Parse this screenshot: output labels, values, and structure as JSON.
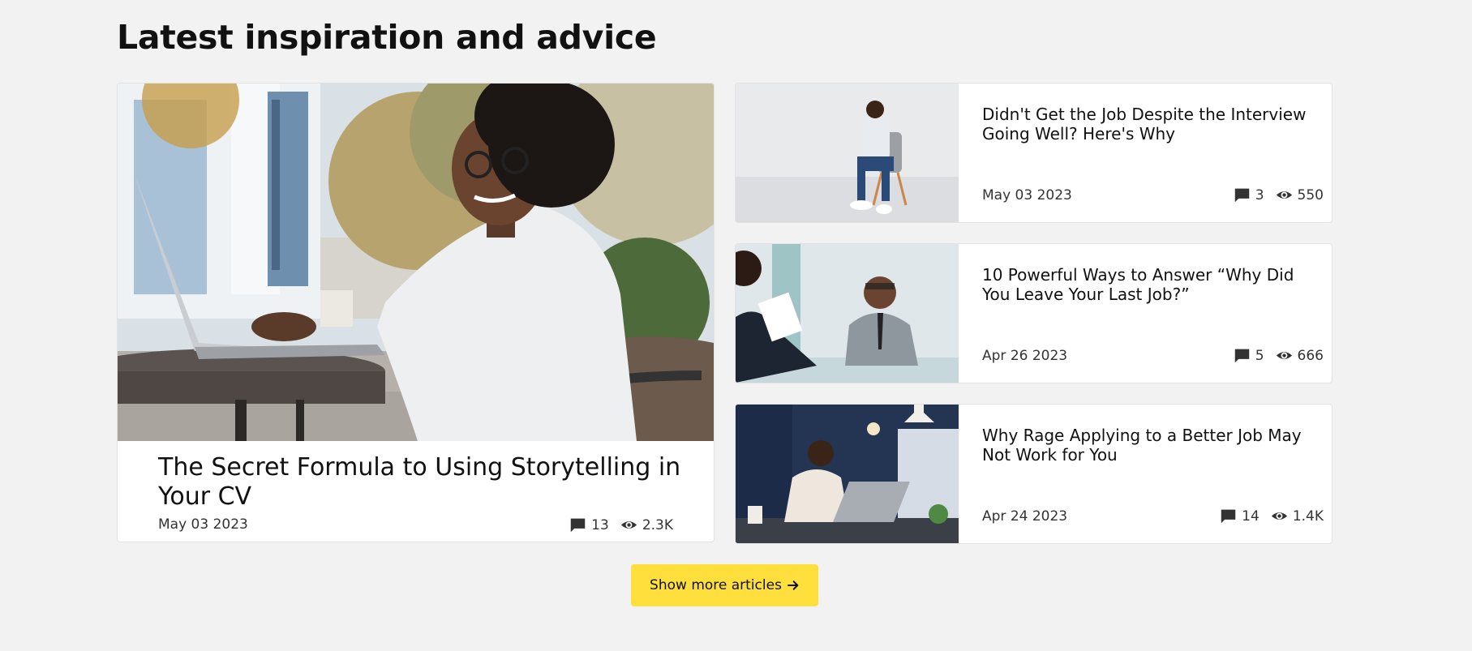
{
  "section": {
    "title": "Latest inspiration and advice"
  },
  "featured": {
    "title": "The Secret Formula to Using Storytelling in Your CV",
    "date": "May 03 2023",
    "comments": "13",
    "views": "2.3K"
  },
  "articles": [
    {
      "title": "Didn't Get the Job Despite the Interview Going Well? Here's Why",
      "date": "May 03 2023",
      "comments": "3",
      "views": "550"
    },
    {
      "title": "10 Powerful Ways to Answer “Why Did You Leave Your Last Job?”",
      "date": "Apr 26 2023",
      "comments": "5",
      "views": "666"
    },
    {
      "title": "Why Rage Applying to a Better Job May Not Work for You",
      "date": "Apr 24 2023",
      "comments": "14",
      "views": "1.4K"
    }
  ],
  "cta": {
    "label": "Show more articles",
    "icon": "arrow-right-icon"
  },
  "colors": {
    "accent": "#ffdf3c",
    "background": "#f2f2f2",
    "card": "#ffffff"
  }
}
